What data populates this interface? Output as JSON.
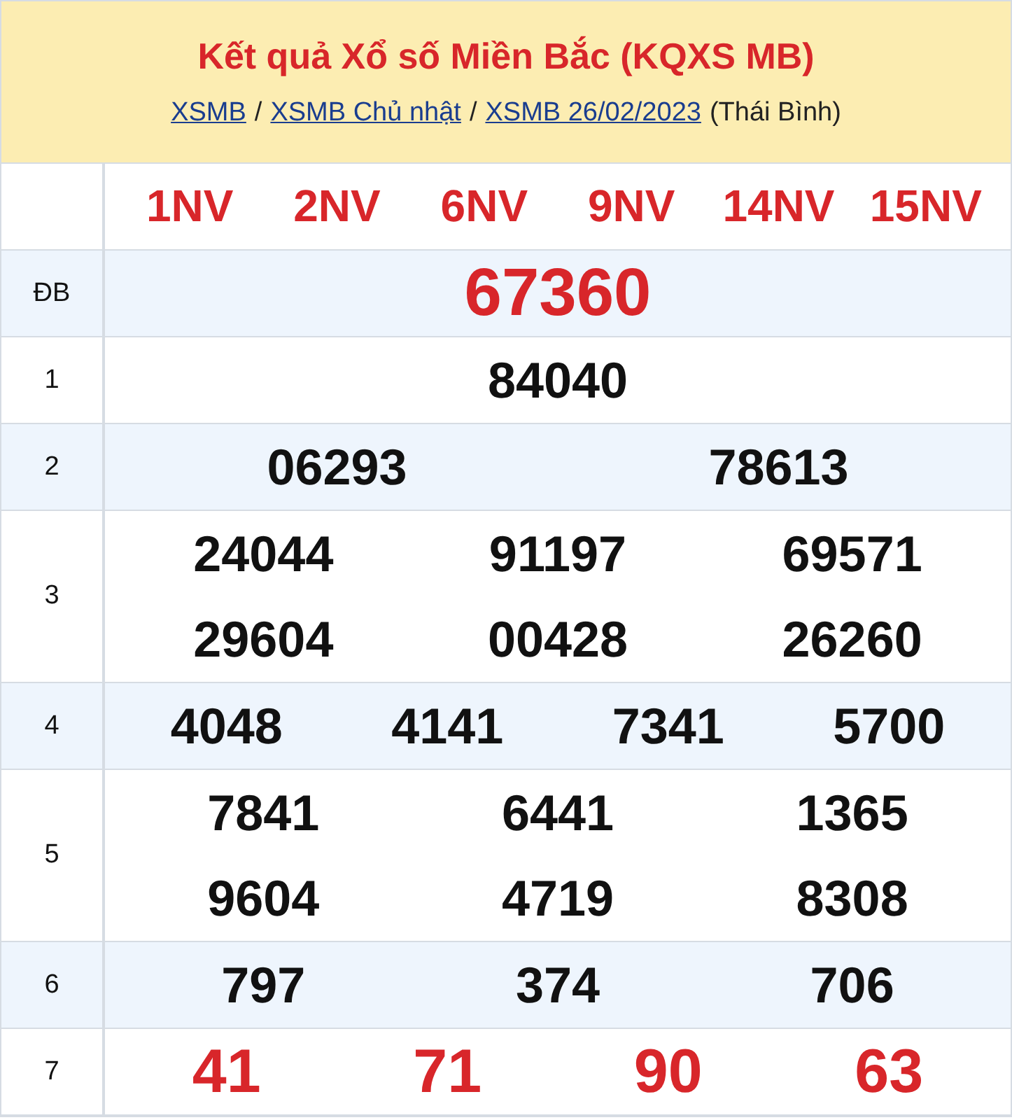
{
  "header": {
    "title": "Kết quả Xổ số Miền Bắc (KQXS MB)",
    "breadcrumbs": [
      {
        "label": "XSMB",
        "kind": "link"
      },
      {
        "label": "/",
        "kind": "separator"
      },
      {
        "label": "XSMB Chủ nhật",
        "kind": "link"
      },
      {
        "label": "/",
        "kind": "separator"
      },
      {
        "label": "XSMB 26/02/2023",
        "kind": "link"
      },
      {
        "label": "(Thái Bình)",
        "kind": "text"
      }
    ]
  },
  "codes": [
    "1NV",
    "2NV",
    "6NV",
    "9NV",
    "14NV",
    "15NV"
  ],
  "prizes": [
    {
      "label": "ĐB",
      "kind": "jackpot",
      "shaded": true,
      "lines": [
        [
          "67360"
        ]
      ]
    },
    {
      "label": "1",
      "kind": "normal",
      "shaded": false,
      "lines": [
        [
          "84040"
        ]
      ]
    },
    {
      "label": "2",
      "kind": "normal",
      "shaded": true,
      "lines": [
        [
          "06293",
          "78613"
        ]
      ]
    },
    {
      "label": "3",
      "kind": "normal",
      "shaded": false,
      "lines": [
        [
          "24044",
          "91197",
          "69571"
        ],
        [
          "29604",
          "00428",
          "26260"
        ]
      ]
    },
    {
      "label": "4",
      "kind": "normal",
      "shaded": true,
      "lines": [
        [
          "4048",
          "4141",
          "7341",
          "5700"
        ]
      ]
    },
    {
      "label": "5",
      "kind": "normal",
      "shaded": false,
      "lines": [
        [
          "7841",
          "6441",
          "1365"
        ],
        [
          "9604",
          "4719",
          "8308"
        ]
      ]
    },
    {
      "label": "6",
      "kind": "normal",
      "shaded": true,
      "lines": [
        [
          "797",
          "374",
          "706"
        ]
      ]
    },
    {
      "label": "7",
      "kind": "red",
      "shaded": false,
      "lines": [
        [
          "41",
          "71",
          "90",
          "63"
        ]
      ]
    }
  ]
}
